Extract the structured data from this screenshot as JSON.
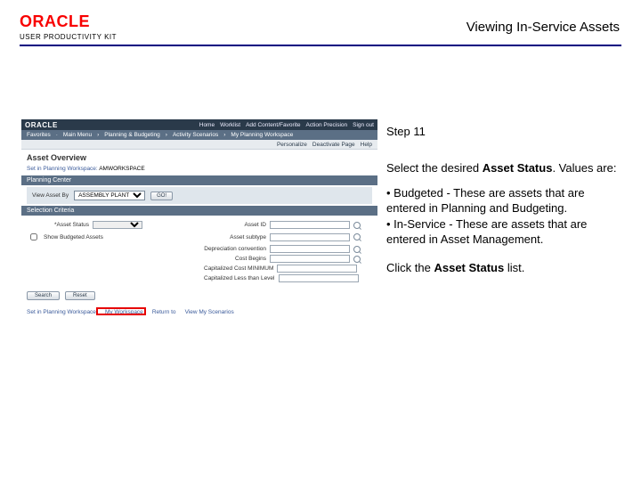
{
  "header": {
    "brand": "ORACLE",
    "product": "USER PRODUCTIVITY KIT",
    "doc_title": "Viewing In-Service Assets"
  },
  "screenshot": {
    "topbar_brand": "ORACLE",
    "topbar_links": [
      "Home",
      "Worklist",
      "Add Content/Favorite",
      "Action Precision",
      "Sign out"
    ],
    "menubar": [
      "Favorites",
      "Main Menu",
      "Planning & Budgeting",
      "Activity Scenarios",
      "My Planning Workspace"
    ],
    "subbar": [
      "Personalize",
      "Deactivate Page",
      "Help"
    ],
    "page_title": "Asset Overview",
    "crumb_prefix": "Set in Planning Workspace:",
    "crumb_value": "AMWORKSPACE",
    "section1": "Planning Center",
    "panel_label": "View Asset By",
    "panel_value": "ASSEMBLY PLANT",
    "panel_go": "GO!",
    "section2": "Selection Criteria",
    "fields": {
      "left": [
        {
          "label": "*Asset Status",
          "value": ""
        },
        {
          "label": "Show Budgeted Assets",
          "checkbox": true
        }
      ],
      "right": [
        {
          "label": "Asset ID"
        },
        {
          "label": "Asset subtype"
        },
        {
          "label": "Depreciation convention"
        },
        {
          "label": "Cost Begins"
        },
        {
          "label": "Capitalized Cost MINIMUM"
        },
        {
          "label": "Capitalized Less than Level"
        }
      ]
    },
    "buttons": [
      "Search",
      "Reset"
    ],
    "footer_links": [
      "Set in Planning Workspace",
      "My Workspace",
      "Return to",
      "View My Scenarios"
    ]
  },
  "right": {
    "step": "Step 11",
    "p1a": "Select the desired ",
    "p1b": "Asset Status",
    "p1c": ". Values are:",
    "b1": "• Budgeted - These are assets that are entered in Planning and Budgeting.",
    "b2": "• In-Service - These are assets that are entered in Asset Management.",
    "p2a": "Click the ",
    "p2b": "Asset Status",
    "p2c": " list."
  }
}
